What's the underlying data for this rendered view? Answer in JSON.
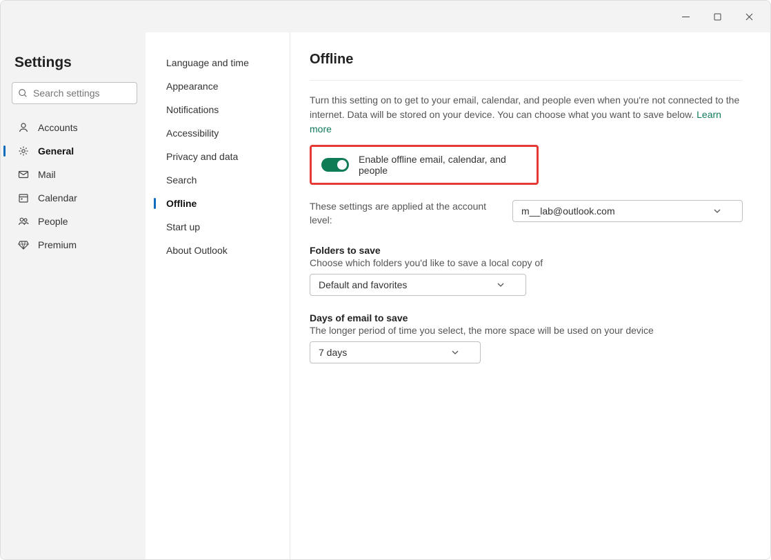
{
  "window_controls": {
    "minimize": "minimize-icon",
    "maximize": "maximize-icon",
    "close": "close-icon"
  },
  "sidebar1": {
    "title": "Settings",
    "search_placeholder": "Search settings",
    "items": [
      {
        "label": "Accounts",
        "icon": "person-icon",
        "active": false
      },
      {
        "label": "General",
        "icon": "gear-icon",
        "active": true
      },
      {
        "label": "Mail",
        "icon": "mail-icon",
        "active": false
      },
      {
        "label": "Calendar",
        "icon": "calendar-icon",
        "active": false
      },
      {
        "label": "People",
        "icon": "people-icon",
        "active": false
      },
      {
        "label": "Premium",
        "icon": "diamond-icon",
        "active": false
      }
    ]
  },
  "sidebar2": {
    "items": [
      {
        "label": "Language and time",
        "active": false
      },
      {
        "label": "Appearance",
        "active": false
      },
      {
        "label": "Notifications",
        "active": false
      },
      {
        "label": "Accessibility",
        "active": false
      },
      {
        "label": "Privacy and data",
        "active": false
      },
      {
        "label": "Search",
        "active": false
      },
      {
        "label": "Offline",
        "active": true
      },
      {
        "label": "Start up",
        "active": false
      },
      {
        "label": "About Outlook",
        "active": false
      }
    ]
  },
  "main": {
    "title": "Offline",
    "description": "Turn this setting on to get to your email, calendar, and people even when you're not connected to the internet. Data will be stored on your device. You can choose what you want to save below.",
    "learn_more": "Learn more",
    "toggle": {
      "on": true,
      "label": "Enable offline email, calendar, and people"
    },
    "account_row": {
      "desc": "These settings are applied at the account level:",
      "selected": "m__lab@outlook.com"
    },
    "folders": {
      "title": "Folders to save",
      "desc": "Choose which folders you'd like to save a local copy of",
      "selected": "Default and favorites"
    },
    "days": {
      "title": "Days of email to save",
      "desc": "The longer period of time you select, the more space will be used on your device",
      "selected": "7 days"
    }
  }
}
